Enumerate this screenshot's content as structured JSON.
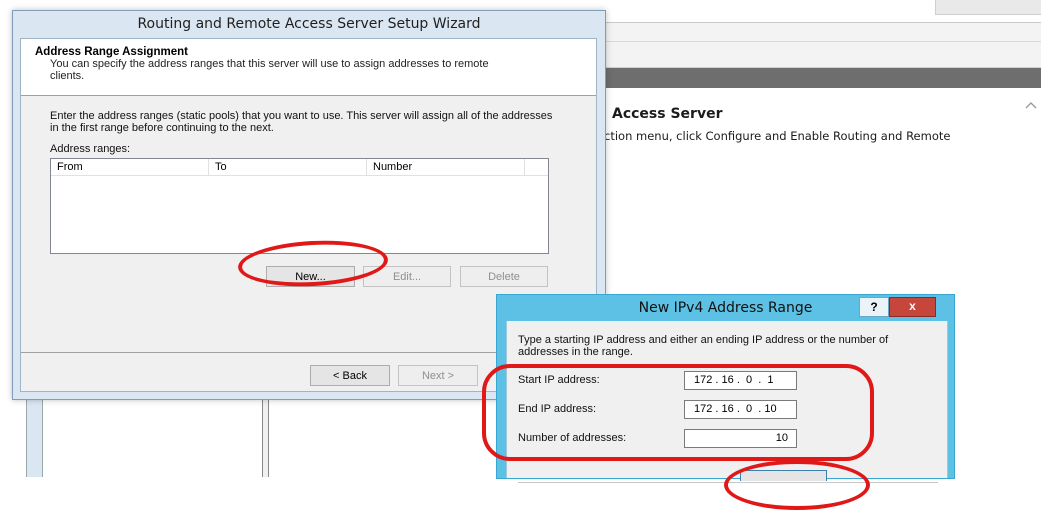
{
  "background_window": {
    "heading": "Access Server",
    "text": "ction menu, click Configure and Enable Routing and Remote",
    "scroll_arrow": "^"
  },
  "wizard": {
    "title": "Routing and Remote Access Server Setup Wizard",
    "header_title": "Address Range Assignment",
    "header_subtitle": "You can specify the address ranges that this server will use to assign addresses to remote clients.",
    "instructions": "Enter the address ranges (static pools) that you want to use. This server will assign all of the addresses in the first range before continuing to the next.",
    "list_label": "Address ranges:",
    "columns": [
      "From",
      "To",
      "Number"
    ],
    "buttons": {
      "new": "New...",
      "edit": "Edit...",
      "delete": "Delete",
      "back": "< Back",
      "next": "Next >"
    }
  },
  "ipv4_dialog": {
    "title": "New IPv4 Address Range",
    "help": "?",
    "close": "x",
    "description": "Type a starting IP address and either an ending IP address or the number of addresses in the range.",
    "start_label": "Start IP address:",
    "start_value": "172 . 16 .  0  .  1",
    "end_label": "End IP address:",
    "end_value": "172 . 16 .  0  . 10",
    "count_label": "Number of addresses:",
    "count_value": "10"
  },
  "highlight_color": "#e01818"
}
